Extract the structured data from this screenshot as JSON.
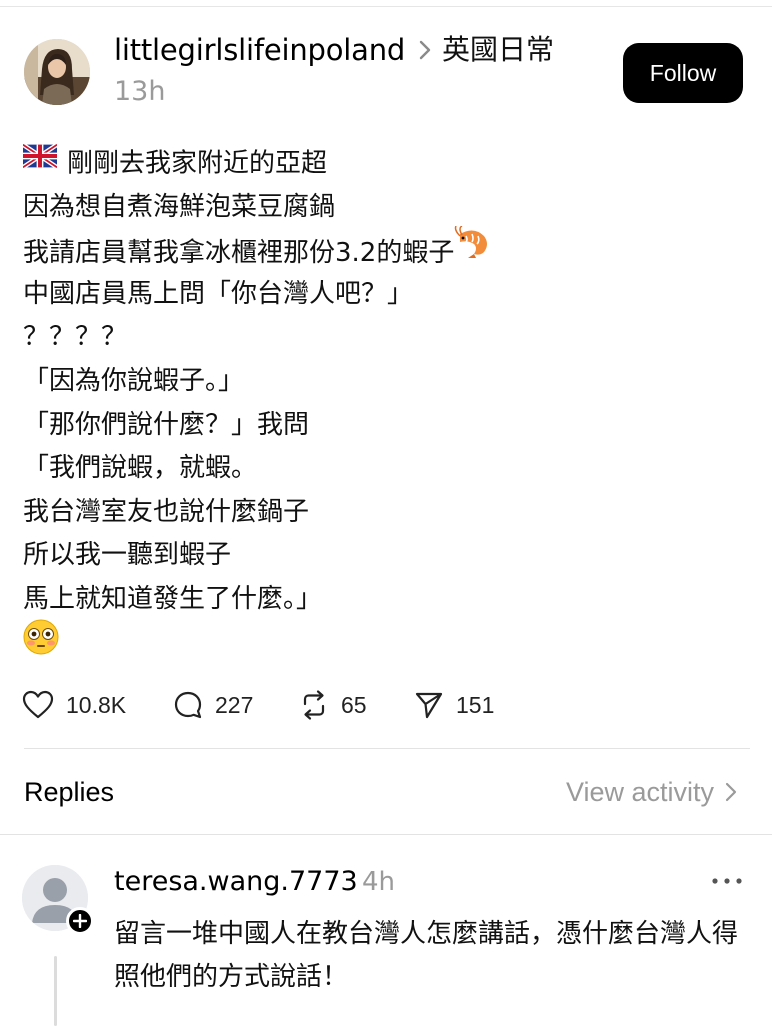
{
  "post": {
    "username": "littlegirlslifeinpoland",
    "topic": "英國日常",
    "time": "13h",
    "follow_label": "Follow",
    "lines": [
      "剛剛去我家附近的亞超",
      "因為想自煮海鮮泡菜豆腐鍋",
      "我請店員幫我拿冰櫃裡那份3.2的蝦子",
      "中國店員馬上問「你台灣人吧？」",
      "？？？？",
      "「因為你說蝦子。」",
      "「那你們說什麼？」我問",
      "「我們說蝦，就蝦。",
      "我台灣室友也說什麼鍋子",
      "所以我一聽到蝦子",
      "馬上就知道發生了什麼。」"
    ],
    "emoji_icons": [
      "uk-flag-icon",
      "shrimp-icon",
      "flushed-face-icon"
    ]
  },
  "actions": {
    "likes": "10.8K",
    "comments": "227",
    "reposts": "65",
    "shares": "151"
  },
  "section": {
    "replies_label": "Replies",
    "view_activity_label": "View activity"
  },
  "reply": {
    "username": "teresa.wang.7773",
    "time": "4h",
    "text": "留言一堆中國人在教台灣人怎麼講話，憑什麼台灣人得照他們的方式說話！"
  },
  "colors": {
    "follow_bg": "#000000",
    "muted": "#9a9a9a",
    "divider": "#e3e3e3"
  }
}
